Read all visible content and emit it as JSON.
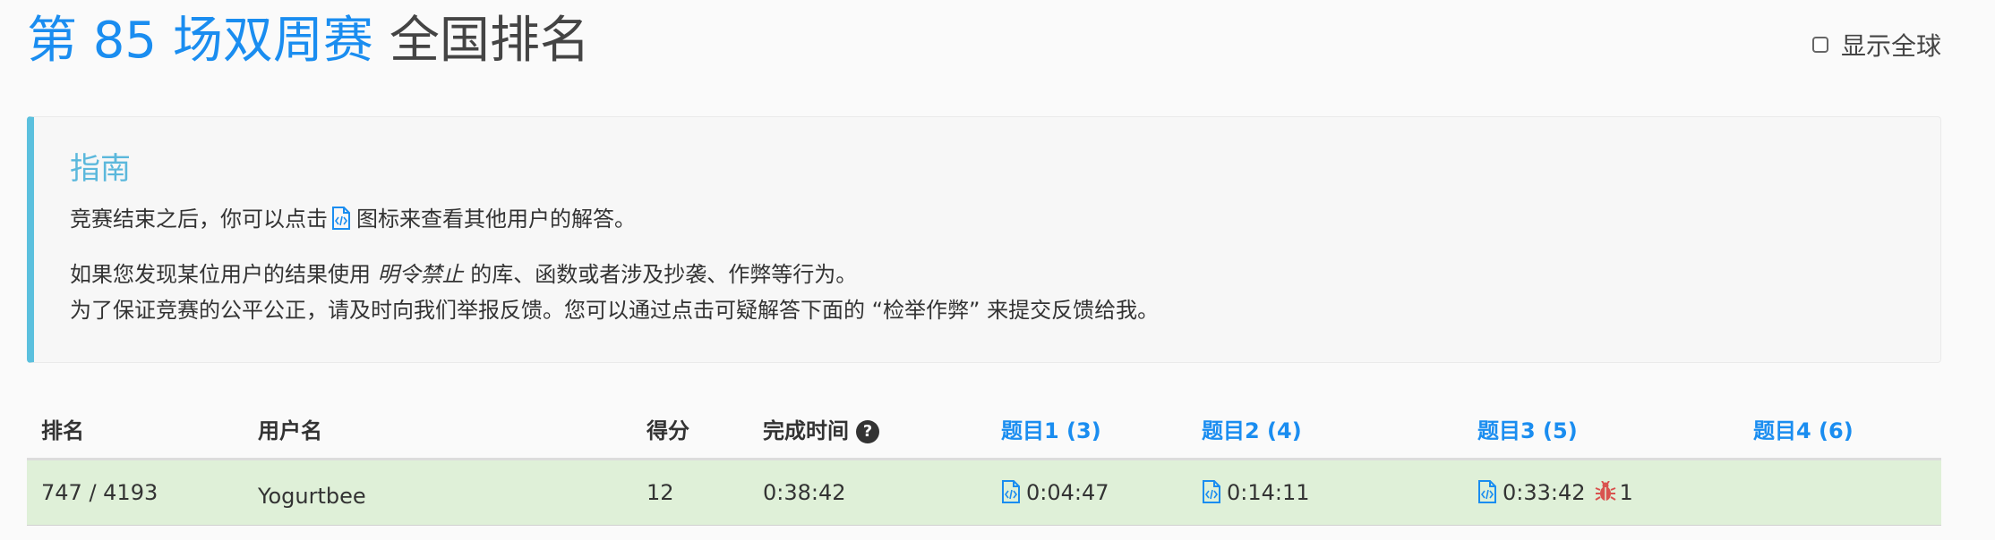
{
  "header": {
    "contest_name": "第 85 场双周赛",
    "ranking_label": "全国排名",
    "show_global_label": "显示全球"
  },
  "guide": {
    "title": "指南",
    "line1_before": "竞赛结束之后，你可以点击",
    "line1_after": "图标来查看其他用户的解答。",
    "line2_before": "如果您发现某位用户的结果使用",
    "line2_em": "明令禁止",
    "line2_after": "的库、函数或者涉及抄袭、作弊等行为。",
    "line3": "为了保证竞赛的公平公正，请及时向我们举报反馈。您可以通过点击可疑解答下面的 “检举作弊” 来提交反馈给我。"
  },
  "table": {
    "columns": {
      "rank": "排名",
      "username": "用户名",
      "score": "得分",
      "finish_time": "完成时间",
      "q1": "题目1 (3)",
      "q2": "题目2 (4)",
      "q3": "题目3 (5)",
      "q4": "题目4 (6)"
    },
    "rows": [
      {
        "rank": "747 / 4193",
        "username": "Yogurtbee",
        "score": "12",
        "finish_time": "0:38:42",
        "q1": "0:04:47",
        "q2": "0:14:11",
        "q3": "0:33:42",
        "q3_bugs": "1",
        "q4": ""
      }
    ]
  },
  "colors": {
    "accent": "#1a8df0",
    "guide_border": "#5bc0de",
    "row_highlight": "#dff0d8",
    "bug": "#d9534f"
  }
}
